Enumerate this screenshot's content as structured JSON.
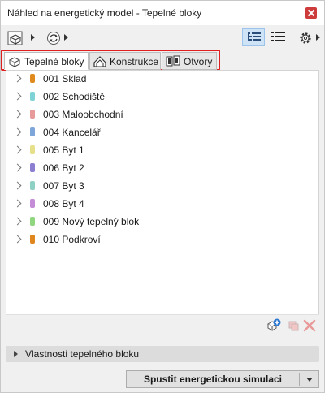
{
  "window": {
    "title": "Náhled na energetický model - Tepelné bloky"
  },
  "toolbar": {
    "icons": [
      "model-cube-icon",
      "refresh-icon",
      "list-view-icon",
      "details-view-icon",
      "settings-gear-icon"
    ],
    "active_view": "list-view-icon"
  },
  "tabs": [
    {
      "label": "Tepelné bloky",
      "icon": "thermal-block-icon",
      "active": true
    },
    {
      "label": "Konstrukce",
      "icon": "construction-icon",
      "active": false
    },
    {
      "label": "Otvory",
      "icon": "openings-icon",
      "active": false
    }
  ],
  "thermal_blocks": [
    {
      "label": "001 Sklad",
      "color": "#e08a1e"
    },
    {
      "label": "002 Schodiště",
      "color": "#7fd3d6"
    },
    {
      "label": "003 Maloobchodní",
      "color": "#e79a9a"
    },
    {
      "label": "004 Kancelář",
      "color": "#7fa6d8"
    },
    {
      "label": "005 Byt 1",
      "color": "#e6e08a"
    },
    {
      "label": "006 Byt 2",
      "color": "#8c7fd1"
    },
    {
      "label": "007 Byt 3",
      "color": "#8fd0c4"
    },
    {
      "label": "008 Byt 4",
      "color": "#c48bd6"
    },
    {
      "label": "009 Nový tepelný blok",
      "color": "#8fd67f"
    },
    {
      "label": "010 Podkroví",
      "color": "#e0861e"
    }
  ],
  "bottom_tools": [
    "add-block-icon",
    "copy-block-icon",
    "delete-icon"
  ],
  "properties": {
    "label": "Vlastnosti tepelného bloku"
  },
  "run": {
    "label": "Spustit energetickou simulaci"
  },
  "colors": {
    "highlight_box": "#e02020",
    "active_view_bg": "#cfe3f7",
    "delete_icon": "#d9534f"
  }
}
